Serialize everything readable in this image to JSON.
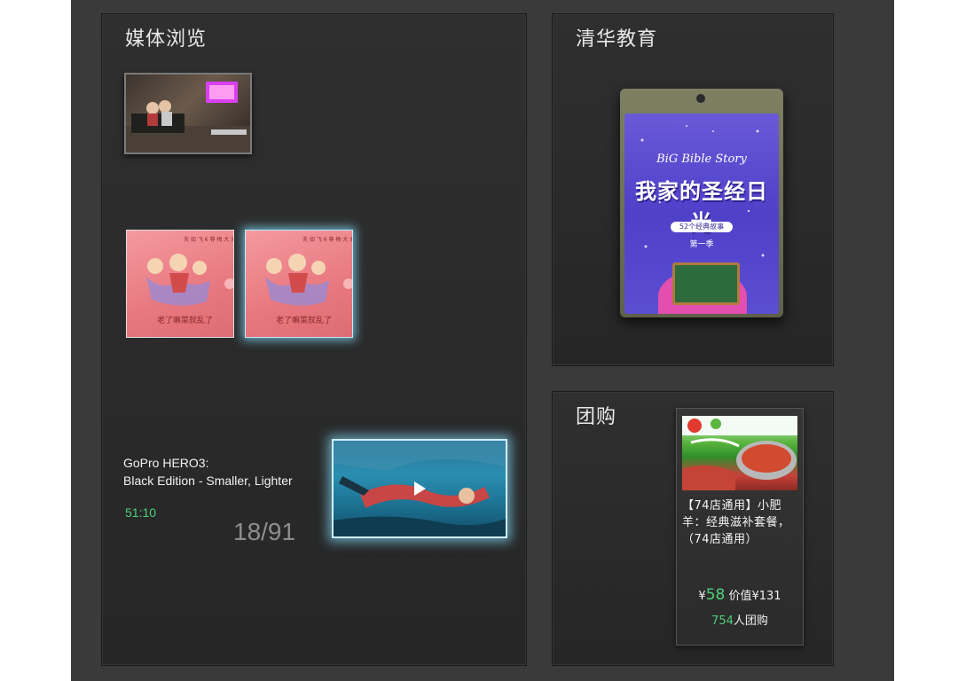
{
  "media": {
    "title": "媒体浏览",
    "video": {
      "title_line1": "GoPro HERO3:",
      "title_line2": "Black Edition - Smaller, Lighter",
      "duration": "51:10"
    },
    "page_counter": "18/91"
  },
  "education": {
    "title": "清华教育",
    "book": {
      "title_en": "BiG Bible Story",
      "title_cn": "我家的圣经日光",
      "badge": "52个经典故事",
      "season": "第一季"
    }
  },
  "group_buy": {
    "title": "团购",
    "deal": {
      "title": "【74店通用】小肥羊：经典滋补套餐，（74店通用）",
      "currency": "¥",
      "price": "58",
      "original_price_label": "价值¥131",
      "buyers_count": "754",
      "buyers_suffix": "人团购"
    }
  },
  "colors": {
    "accent_green": "#4fd07a",
    "panel_bg": "#2b2b2b",
    "stage_bg": "#3a3a3a"
  }
}
